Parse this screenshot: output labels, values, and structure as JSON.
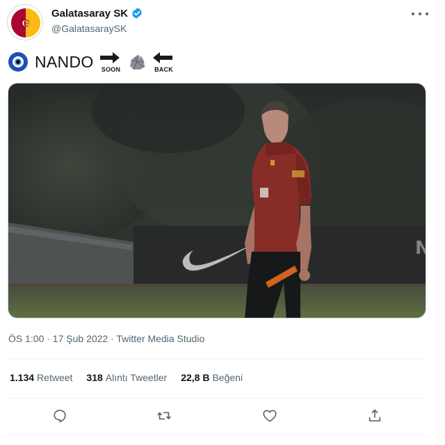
{
  "tweet": {
    "author": {
      "display_name": "Galatasaray SK",
      "handle": "@GalatasaraySK",
      "verified": true,
      "avatar_icon": "galatasaray-crest-icon"
    },
    "text": {
      "prefix_icon": "nazar-amulet-icon",
      "word": "NANDO",
      "soon_label": "SOON",
      "middle_icon": "rock-icon",
      "back_label": "BACK"
    },
    "media": {
      "icon": "training-photo"
    },
    "meta": "ÖS 1:00 · 17 Şub 2022 · Twitter Media Studio",
    "stats": [
      {
        "count": "1.134",
        "label": "Retweet"
      },
      {
        "count": "318",
        "label": "Alıntı Tweetler"
      },
      {
        "count": "22,8 B",
        "label": "Beğeni"
      }
    ],
    "actions": [
      "reply-icon",
      "retweet-icon",
      "like-icon",
      "share-icon"
    ]
  },
  "colors": {
    "text": "#0f1419",
    "secondary": "#536471",
    "verified": "#1d9bf0",
    "border": "#eff3f4",
    "galatasaray_red": "#a90432",
    "galatasaray_yellow": "#fdb912"
  }
}
